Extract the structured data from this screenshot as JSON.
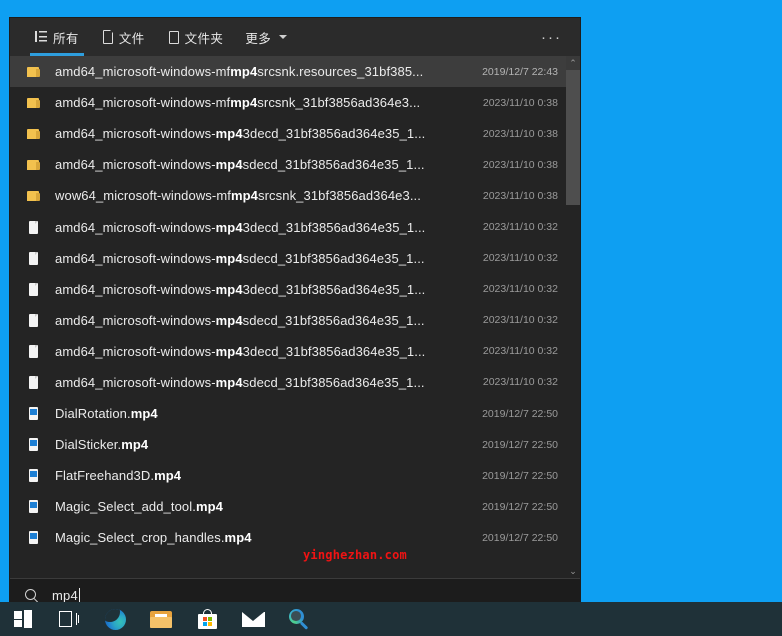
{
  "desktop": {
    "background_color": "#0e9ff2"
  },
  "search_panel": {
    "tabs": [
      {
        "label": "所有",
        "icon": "list-icon",
        "active": true
      },
      {
        "label": "文件",
        "icon": "page-icon",
        "active": false
      },
      {
        "label": "文件夹",
        "icon": "folder-outline-icon",
        "active": false
      },
      {
        "label": "更多",
        "icon": "chevron-down-icon",
        "active": false
      }
    ],
    "overflow_label": "···",
    "results": [
      {
        "icon": "folder-icon",
        "pre": "amd64_microsoft-windows-mf",
        "match": "mp4",
        "post": "srcsnk.resources_31bf385...",
        "date": "2019/12/7 22:43",
        "selected": true
      },
      {
        "icon": "folder-icon",
        "pre": "amd64_microsoft-windows-mf",
        "match": "mp4",
        "post": "srcsnk_31bf3856ad364e3...",
        "date": "2023/11/10 0:38",
        "selected": false
      },
      {
        "icon": "folder-icon",
        "pre": "amd64_microsoft-windows-",
        "match": "mp4",
        "post": "3decd_31bf3856ad364e35_1...",
        "date": "2023/11/10 0:38",
        "selected": false
      },
      {
        "icon": "folder-icon",
        "pre": "amd64_microsoft-windows-",
        "match": "mp4",
        "post": "sdecd_31bf3856ad364e35_1...",
        "date": "2023/11/10 0:38",
        "selected": false
      },
      {
        "icon": "folder-icon",
        "pre": "wow64_microsoft-windows-mf",
        "match": "mp4",
        "post": "srcsnk_31bf3856ad364e3...",
        "date": "2023/11/10 0:38",
        "selected": false
      },
      {
        "icon": "document-icon",
        "pre": "amd64_microsoft-windows-",
        "match": "mp4",
        "post": "3decd_31bf3856ad364e35_1...",
        "date": "2023/11/10 0:32",
        "selected": false
      },
      {
        "icon": "document-icon",
        "pre": "amd64_microsoft-windows-",
        "match": "mp4",
        "post": "sdecd_31bf3856ad364e35_1...",
        "date": "2023/11/10 0:32",
        "selected": false
      },
      {
        "icon": "document-icon",
        "pre": "amd64_microsoft-windows-",
        "match": "mp4",
        "post": "3decd_31bf3856ad364e35_1...",
        "date": "2023/11/10 0:32",
        "selected": false
      },
      {
        "icon": "document-icon",
        "pre": "amd64_microsoft-windows-",
        "match": "mp4",
        "post": "sdecd_31bf3856ad364e35_1...",
        "date": "2023/11/10 0:32",
        "selected": false
      },
      {
        "icon": "document-icon",
        "pre": "amd64_microsoft-windows-",
        "match": "mp4",
        "post": "3decd_31bf3856ad364e35_1...",
        "date": "2023/11/10 0:32",
        "selected": false
      },
      {
        "icon": "document-icon",
        "pre": "amd64_microsoft-windows-",
        "match": "mp4",
        "post": "sdecd_31bf3856ad364e35_1...",
        "date": "2023/11/10 0:32",
        "selected": false
      },
      {
        "icon": "media-file-icon",
        "pre": "DialRotation.",
        "match": "mp4",
        "post": "",
        "date": "2019/12/7 22:50",
        "selected": false
      },
      {
        "icon": "media-file-icon",
        "pre": "DialSticker.",
        "match": "mp4",
        "post": "",
        "date": "2019/12/7 22:50",
        "selected": false
      },
      {
        "icon": "media-file-icon",
        "pre": "FlatFreehand3D.",
        "match": "mp4",
        "post": "",
        "date": "2019/12/7 22:50",
        "selected": false
      },
      {
        "icon": "media-file-icon",
        "pre": "Magic_Select_add_tool.",
        "match": "mp4",
        "post": "",
        "date": "2019/12/7 22:50",
        "selected": false
      },
      {
        "icon": "media-file-icon",
        "pre": "Magic_Select_crop_handles.",
        "match": "mp4",
        "post": "",
        "date": "2019/12/7 22:50",
        "selected": false
      }
    ],
    "scrollbar": {
      "up_arrow": "⌃",
      "down_arrow": "⌄"
    },
    "search_input": {
      "value": "mp4",
      "icon": "search-icon"
    }
  },
  "watermark": {
    "text": "yinghezhan.com",
    "color": "#f01313"
  },
  "taskbar": {
    "background_color": "#1f3138",
    "items": [
      {
        "name": "start-button",
        "icon": "windows-logo-icon"
      },
      {
        "name": "task-view-button",
        "icon": "task-view-icon"
      },
      {
        "name": "edge-button",
        "icon": "edge-icon"
      },
      {
        "name": "file-explorer-button",
        "icon": "folder-icon"
      },
      {
        "name": "microsoft-store-button",
        "icon": "store-bag-icon"
      },
      {
        "name": "mail-button",
        "icon": "envelope-icon"
      },
      {
        "name": "search-button",
        "icon": "magnifier-icon"
      }
    ]
  }
}
